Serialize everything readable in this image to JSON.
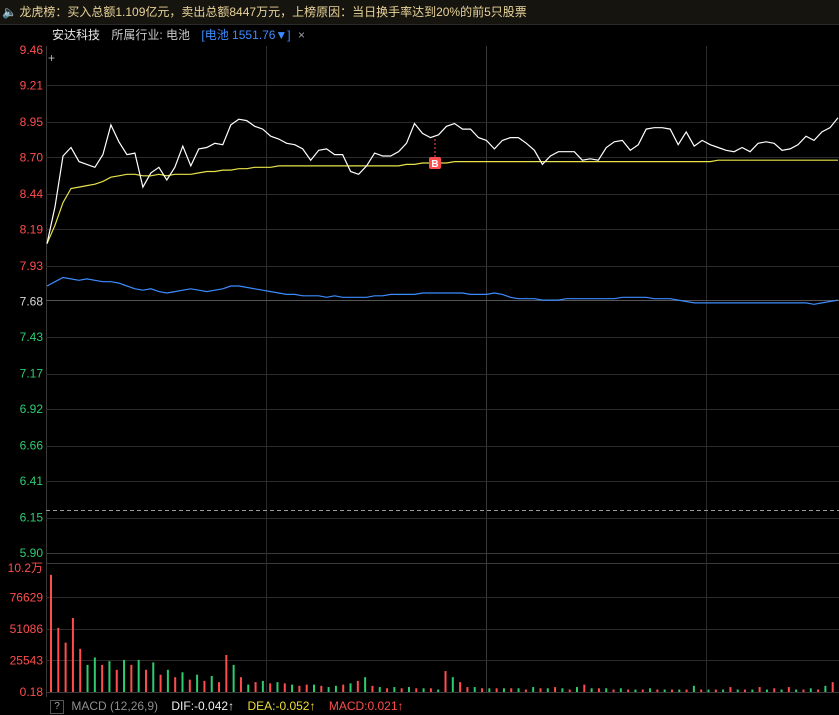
{
  "banner": {
    "icon": "speaker-icon",
    "text": "龙虎榜：买入总额1.109亿元，卖出总额8447万元，上榜原因：当日换手率达到20%的前5只股票"
  },
  "stock": {
    "name": "安达科技",
    "industry_label": "所属行业: 电池",
    "index_tag": "[电池 1551.76▼]",
    "close_symbol": "×"
  },
  "macd_bar": {
    "help": "?",
    "label": "MACD (12,26,9)",
    "dif": "DIF:-0.042↑",
    "dea": "DEA:-0.052↑",
    "macd": "MACD:0.021↑"
  },
  "colors": {
    "price_line": "#ffffff",
    "avg_line": "#e8e34a",
    "blue_line": "#3d8cff",
    "up": "#ff4d4d",
    "down": "#2ecc71",
    "grid": "#2b2b2b"
  },
  "chart_data": [
    {
      "type": "line",
      "title": "",
      "y_ticks": [
        "9.46",
        "9.21",
        "8.95",
        "8.70",
        "8.44",
        "8.19",
        "7.93",
        "7.68",
        "7.43",
        "7.17",
        "6.92",
        "6.66",
        "6.41",
        "6.15",
        "5.90"
      ],
      "y_tick_colors": [
        "up",
        "up",
        "up",
        "up",
        "up",
        "up",
        "up",
        "neutral",
        "down",
        "down",
        "down",
        "down",
        "down",
        "down",
        "down"
      ],
      "ylim": [
        5.9,
        9.46
      ],
      "prev_close": 7.68,
      "reference_dashed": 6.19,
      "marker": {
        "label": "B",
        "x_index": 99
      },
      "series": [
        {
          "key": "price",
          "values": [
            8.09,
            8.35,
            8.71,
            8.77,
            8.67,
            8.65,
            8.63,
            8.72,
            8.93,
            8.81,
            8.72,
            8.73,
            8.49,
            8.59,
            8.63,
            8.54,
            8.63,
            8.78,
            8.64,
            8.76,
            8.77,
            8.8,
            8.79,
            8.93,
            8.97,
            8.96,
            8.92,
            8.9,
            8.85,
            8.83,
            8.8,
            8.79,
            8.76,
            8.68,
            8.75,
            8.76,
            8.72,
            8.72,
            8.6,
            8.58,
            8.64,
            8.73,
            8.71,
            8.71,
            8.74,
            8.8,
            8.94,
            8.87,
            8.84,
            8.86,
            8.92,
            8.94,
            8.9,
            8.9,
            8.84,
            8.82,
            8.76,
            8.82,
            8.84,
            8.84,
            8.8,
            8.75,
            8.65,
            8.71,
            8.74,
            8.74,
            8.74,
            8.68,
            8.69,
            8.68,
            8.77,
            8.81,
            8.82,
            8.75,
            8.79,
            8.9,
            8.91,
            8.91,
            8.9,
            8.79,
            8.88,
            8.78,
            8.82,
            8.79,
            8.77,
            8.75,
            8.74,
            8.77,
            8.74,
            8.8,
            8.81,
            8.8,
            8.75,
            8.76,
            8.79,
            8.85,
            8.82,
            8.88,
            8.91,
            8.98
          ]
        },
        {
          "key": "avg",
          "values": [
            8.09,
            8.22,
            8.38,
            8.48,
            8.49,
            8.5,
            8.51,
            8.53,
            8.56,
            8.57,
            8.58,
            8.58,
            8.57,
            8.57,
            8.58,
            8.57,
            8.58,
            8.58,
            8.58,
            8.59,
            8.6,
            8.6,
            8.61,
            8.61,
            8.62,
            8.62,
            8.63,
            8.63,
            8.63,
            8.64,
            8.64,
            8.64,
            8.64,
            8.64,
            8.64,
            8.64,
            8.64,
            8.64,
            8.64,
            8.64,
            8.64,
            8.64,
            8.64,
            8.64,
            8.64,
            8.65,
            8.65,
            8.66,
            8.66,
            8.66,
            8.66,
            8.67,
            8.67,
            8.67,
            8.67,
            8.67,
            8.67,
            8.67,
            8.67,
            8.67,
            8.67,
            8.67,
            8.67,
            8.67,
            8.67,
            8.67,
            8.67,
            8.67,
            8.67,
            8.67,
            8.67,
            8.67,
            8.67,
            8.67,
            8.67,
            8.67,
            8.67,
            8.67,
            8.67,
            8.67,
            8.67,
            8.67,
            8.67,
            8.67,
            8.68,
            8.68,
            8.68,
            8.68,
            8.68,
            8.68,
            8.68,
            8.68,
            8.68,
            8.68,
            8.68,
            8.68,
            8.68,
            8.68,
            8.68,
            8.68
          ]
        },
        {
          "key": "blue",
          "values": [
            7.79,
            7.82,
            7.85,
            7.84,
            7.83,
            7.84,
            7.83,
            7.82,
            7.82,
            7.81,
            7.79,
            7.77,
            7.76,
            7.77,
            7.75,
            7.74,
            7.75,
            7.76,
            7.77,
            7.76,
            7.75,
            7.76,
            7.77,
            7.79,
            7.79,
            7.78,
            7.77,
            7.76,
            7.75,
            7.74,
            7.73,
            7.73,
            7.72,
            7.72,
            7.72,
            7.71,
            7.72,
            7.71,
            7.71,
            7.71,
            7.71,
            7.72,
            7.72,
            7.73,
            7.73,
            7.73,
            7.73,
            7.74,
            7.74,
            7.74,
            7.74,
            7.74,
            7.74,
            7.73,
            7.73,
            7.73,
            7.74,
            7.73,
            7.71,
            7.7,
            7.7,
            7.7,
            7.69,
            7.69,
            7.69,
            7.7,
            7.7,
            7.7,
            7.7,
            7.7,
            7.7,
            7.7,
            7.71,
            7.71,
            7.71,
            7.71,
            7.7,
            7.7,
            7.7,
            7.69,
            7.68,
            7.67,
            7.67,
            7.67,
            7.67,
            7.67,
            7.67,
            7.67,
            7.67,
            7.67,
            7.67,
            7.67,
            7.67,
            7.67,
            7.67,
            7.67,
            7.66,
            7.67,
            7.68,
            7.69
          ]
        }
      ]
    },
    {
      "type": "bar",
      "title": "",
      "y_ticks": [
        "10.2万",
        "76629",
        "51086",
        "25543",
        "0.18"
      ],
      "ylim": [
        0,
        102171
      ],
      "values": [
        95000,
        52000,
        40000,
        60000,
        35000,
        22000,
        28000,
        22000,
        25000,
        18000,
        26000,
        22000,
        26000,
        18000,
        24000,
        14000,
        18000,
        12000,
        16000,
        10000,
        14000,
        9000,
        13000,
        8000,
        30000,
        22000,
        12000,
        6000,
        8000,
        9000,
        7000,
        8000,
        7000,
        6000,
        5000,
        6000,
        6000,
        5000,
        4000,
        5000,
        6000,
        7000,
        9000,
        12000,
        5000,
        4000,
        3000,
        4000,
        3000,
        4000,
        3000,
        3000,
        3000,
        2000,
        17000,
        12000,
        8000,
        4000,
        4000,
        3000,
        3000,
        3000,
        3000,
        3000,
        3000,
        2000,
        4000,
        3000,
        3000,
        4000,
        3000,
        2000,
        4000,
        6000,
        3000,
        3000,
        3000,
        2000,
        3000,
        2000,
        2000,
        2000,
        3000,
        2000,
        2000,
        2000,
        2000,
        2000,
        5000,
        2000,
        2000,
        2000,
        2000,
        4000,
        2000,
        2000,
        2000,
        4000,
        2000,
        3000,
        2000,
        4000,
        2000,
        2000,
        3000,
        2000,
        5000,
        8000
      ],
      "colors": [
        "up",
        "up",
        "up",
        "up",
        "up",
        "down",
        "down",
        "up",
        "down",
        "up",
        "down",
        "up",
        "down",
        "up",
        "down",
        "up",
        "down",
        "up",
        "down",
        "up",
        "down",
        "up",
        "down",
        "up",
        "up",
        "down",
        "up",
        "down",
        "up",
        "down",
        "up",
        "down",
        "up",
        "down",
        "up",
        "up",
        "down",
        "up",
        "down",
        "down",
        "up",
        "down",
        "up",
        "down",
        "up",
        "down",
        "up",
        "down",
        "up",
        "down",
        "up",
        "down",
        "up",
        "down",
        "up",
        "down",
        "up",
        "up",
        "down",
        "up",
        "down",
        "up",
        "down",
        "up",
        "down",
        "up",
        "down",
        "up",
        "down",
        "up",
        "down",
        "up",
        "down",
        "up",
        "down",
        "up",
        "down",
        "up",
        "down",
        "up",
        "down",
        "up",
        "down",
        "up",
        "down",
        "up",
        "down",
        "up",
        "down",
        "up",
        "down",
        "up",
        "down",
        "up",
        "down",
        "up",
        "down",
        "up",
        "down",
        "up",
        "down",
        "up",
        "down",
        "up",
        "down",
        "up",
        "down",
        "up"
      ]
    }
  ]
}
